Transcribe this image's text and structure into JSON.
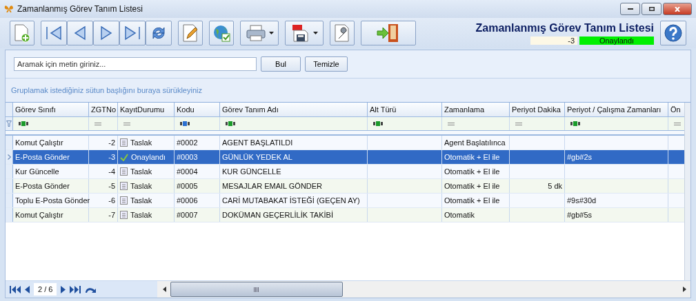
{
  "window": {
    "title": "Zamanlanmış Görev Tanım Listesi"
  },
  "header": {
    "title": "Zamanlanmış Görev Tanım Listesi",
    "record_no": "-3",
    "record_status": "Onaylandı"
  },
  "search": {
    "placeholder": "Aramak için metin giriniz...",
    "buttons": [
      "Bul",
      "Temizle"
    ]
  },
  "group_hint": "Gruplamak istediğiniz sütun başlığını buraya sürükleyiniz",
  "table": {
    "columns": [
      {
        "label": "Görev Sınıfı",
        "kind": "text",
        "filtered": false
      },
      {
        "label": "ZGTNo",
        "kind": "number",
        "filtered": false
      },
      {
        "label": "KayıtDurumu",
        "kind": "number",
        "filtered": false
      },
      {
        "label": "Kodu",
        "kind": "text",
        "filtered": true
      },
      {
        "label": "Görev Tanım Adı",
        "kind": "text",
        "filtered": false
      },
      {
        "label": "Alt Türü",
        "kind": "text",
        "filtered": false
      },
      {
        "label": "Zamanlama",
        "kind": "number",
        "filtered": false
      },
      {
        "label": "Periyot Dakika",
        "kind": "number",
        "filtered": false
      },
      {
        "label": "Periyot / Çalışma Zamanları",
        "kind": "text",
        "filtered": false
      },
      {
        "label": "Ön",
        "kind": "number",
        "filtered": false
      }
    ],
    "rows": [
      {
        "selected": false,
        "approved": false,
        "cells": [
          "Komut Çalıştır",
          "-2",
          "Taslak",
          "#0002",
          "AGENT BAŞLATILDI",
          "",
          "Agent Başlatılınca",
          "",
          "",
          ""
        ]
      },
      {
        "selected": true,
        "approved": true,
        "cells": [
          "E-Posta Gönder",
          "-3",
          "Onaylandı",
          "#0003",
          "GÜNLÜK YEDEK AL",
          "",
          "Otomatik + El ile",
          "",
          "#gb#2s",
          ""
        ]
      },
      {
        "selected": false,
        "approved": false,
        "cells": [
          "Kur Güncelle",
          "-4",
          "Taslak",
          "#0004",
          "KUR GÜNCELLE",
          "",
          "Otomatik + El ile",
          "",
          "",
          ""
        ]
      },
      {
        "selected": false,
        "approved": false,
        "cells": [
          "E-Posta Gönder",
          "-5",
          "Taslak",
          "#0005",
          "MESAJLAR EMAIL GÖNDER",
          "",
          "Otomatik + El ile",
          "5 dk",
          "",
          ""
        ]
      },
      {
        "selected": false,
        "approved": false,
        "cells": [
          "Toplu E-Posta Gönder",
          "-6",
          "Taslak",
          "#0006",
          "CARİ MUTABAKAT İSTEĞİ (GEÇEN AY)",
          "",
          "Otomatik + El ile",
          "",
          "#9s#30d",
          ""
        ]
      },
      {
        "selected": false,
        "approved": false,
        "cells": [
          "Komut Çalıştır",
          "-7",
          "Taslak",
          "#0007",
          "DOKÜMAN GEÇERLİLİK TAKİBİ",
          "",
          "Otomatik",
          "",
          "#gb#5s",
          ""
        ]
      }
    ]
  },
  "pager": {
    "position": "2 / 6"
  }
}
